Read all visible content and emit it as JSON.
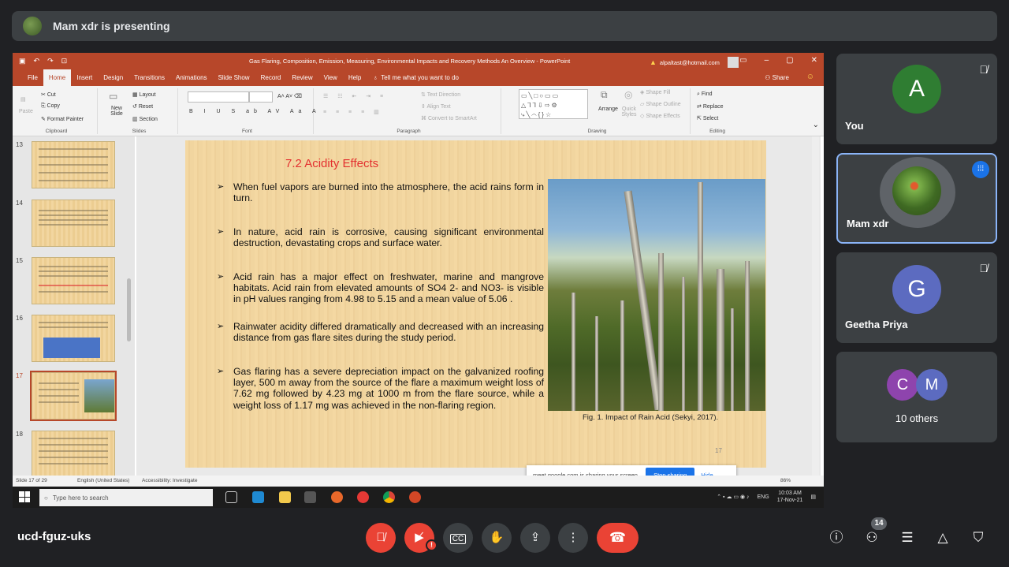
{
  "presenting_banner": {
    "text": "Mam xdr is presenting"
  },
  "powerpoint": {
    "window_title": "Gas Flaring, Composition, Emission, Measuring, Environmental Impacts and Recovery Methods An Overview - PowerPoint",
    "account": "alpaltast@hotmail.com",
    "tabs": [
      "File",
      "Home",
      "Insert",
      "Design",
      "Transitions",
      "Animations",
      "Slide Show",
      "Record",
      "Review",
      "View",
      "Help"
    ],
    "tell_me": "Tell me what you want to do",
    "share": "Share",
    "ribbon": {
      "clipboard": {
        "paste": "Paste",
        "cut": "Cut",
        "copy": "Copy",
        "format_painter": "Format Painter",
        "label": "Clipboard"
      },
      "slides": {
        "new_slide": "New Slide",
        "layout": "Layout",
        "reset": "Reset",
        "section": "Section",
        "label": "Slides"
      },
      "font": {
        "label": "Font"
      },
      "paragraph": {
        "text_direction": "Text Direction",
        "align_text": "Align Text",
        "convert_smartart": "Convert to SmartArt",
        "label": "Paragraph"
      },
      "drawing": {
        "arrange": "Arrange",
        "quick_styles": "Quick Styles",
        "shape_fill": "Shape Fill",
        "shape_outline": "Shape Outline",
        "shape_effects": "Shape Effects",
        "label": "Drawing"
      },
      "editing": {
        "find": "Find",
        "replace": "Replace",
        "select": "Select",
        "label": "Editing"
      }
    },
    "thumbnails": [
      {
        "num": "13"
      },
      {
        "num": "14"
      },
      {
        "num": "15"
      },
      {
        "num": "16"
      },
      {
        "num": "17",
        "selected": true
      },
      {
        "num": "18"
      }
    ],
    "slide": {
      "title": "7.2 Acidity Effects",
      "bullets": [
        "When fuel vapors are burned into the atmosphere, the acid rains form in turn.",
        "In nature, acid rain is corrosive, causing significant environmental destruction, devastating crops and surface water.",
        "Acid rain has a major effect on freshwater, marine and mangrove habitats. Acid rain from elevated amounts of SO4 2- and NO3- is visible in pH values ranging from 4.98 to 5.15 and a mean value of 5.06 .",
        "Rainwater acidity differed dramatically and decreased with an increasing distance from gas flare sites during the study period.",
        "Gas flaring has a severe depreciation impact on the galvanized roofing layer, 500 m away from the source of the flare a maximum weight loss of 7.62 mg followed by 4.23 mg at 1000 m from the flare source, while a weight loss of 1.17 mg was achieved in the non-flaring region."
      ],
      "figure_caption": "Fig. 1. Impact of Rain Acid (Sekyi, 2017).",
      "slide_number": "17"
    },
    "status": {
      "slide_of": "Slide 17 of 29",
      "language": "English (United States)",
      "accessibility": "Accessibility: Investigate",
      "zoom": "86%"
    },
    "share_notice": {
      "text": "meet.google.com is sharing your screen.",
      "stop": "Stop sharing",
      "hide": "Hide"
    }
  },
  "taskbar": {
    "search_placeholder": "Type here to search",
    "lang": "ENG",
    "time": "10:03 AM",
    "date": "17-Nov-21"
  },
  "participants": [
    {
      "name": "You",
      "initial": "A",
      "color": "#2f7d32",
      "muted": true
    },
    {
      "name": "Mam xdr",
      "speaking": true
    },
    {
      "name": "Geetha Priya",
      "initial": "G",
      "color": "#5c6bc0",
      "muted": true
    },
    {
      "name": "10 others",
      "initials": [
        "C",
        "M"
      ],
      "colors": [
        "#8e44ad",
        "#5c6bc0"
      ]
    }
  ],
  "meeting": {
    "code": "ucd-fguz-uks",
    "people_count": "14"
  },
  "colors": {
    "meet_bg": "#202124",
    "tile_bg": "#3c4043",
    "red": "#ea4335",
    "ppt_accent": "#b7472a",
    "title_red": "#e3302f"
  }
}
